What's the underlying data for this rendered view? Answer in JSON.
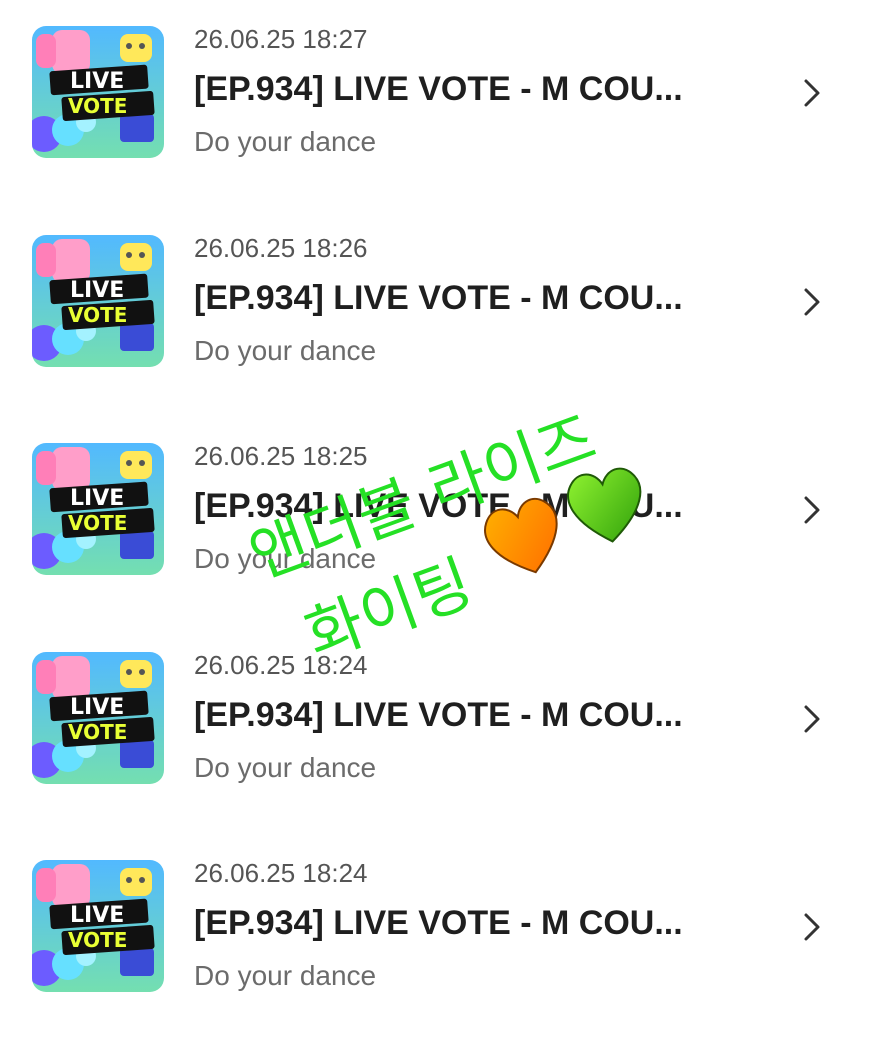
{
  "colors": {
    "thumbnail_gradient_top": "#4ec0ff",
    "thumbnail_gradient_bottom": "#6cd6a8",
    "vote_badge": "#111111",
    "vote_badge_accent": "#e9ff34",
    "live_text": "#ffffff",
    "overlay_text": "#25e025",
    "heart_orange": "#ff8a00",
    "heart_green": "#55cc18"
  },
  "notifications": [
    {
      "time": "26.06.25 18:27",
      "title": "[EP.934] LIVE VOTE - M COU...",
      "subtitle": "Do your dance",
      "thumbnail": {
        "line1": "LIVE",
        "line2": "VOTE"
      },
      "chevron_icon": "chevron-right-icon"
    },
    {
      "time": "26.06.25 18:26",
      "title": "[EP.934] LIVE VOTE - M COU...",
      "subtitle": "Do your dance",
      "thumbnail": {
        "line1": "LIVE",
        "line2": "VOTE"
      },
      "chevron_icon": "chevron-right-icon"
    },
    {
      "time": "26.06.25 18:25",
      "title": "[EP.934] LIVE VOTE - M COU...",
      "subtitle": "Do your dance",
      "thumbnail": {
        "line1": "LIVE",
        "line2": "VOTE"
      },
      "chevron_icon": "chevron-right-icon"
    },
    {
      "time": "26.06.25 18:24",
      "title": "[EP.934] LIVE VOTE - M COU...",
      "subtitle": "Do your dance",
      "thumbnail": {
        "line1": "LIVE",
        "line2": "VOTE"
      },
      "chevron_icon": "chevron-right-icon"
    },
    {
      "time": "26.06.25 18:24",
      "title": "[EP.934] LIVE VOTE - M COU...",
      "subtitle": "Do your dance",
      "thumbnail": {
        "line1": "LIVE",
        "line2": "VOTE"
      },
      "chevron_icon": "chevron-right-icon"
    }
  ],
  "overlay": {
    "line1": "앤더블 라이즈",
    "line2": "화이팅",
    "icons": [
      "orange-heart-icon",
      "green-heart-icon"
    ]
  }
}
